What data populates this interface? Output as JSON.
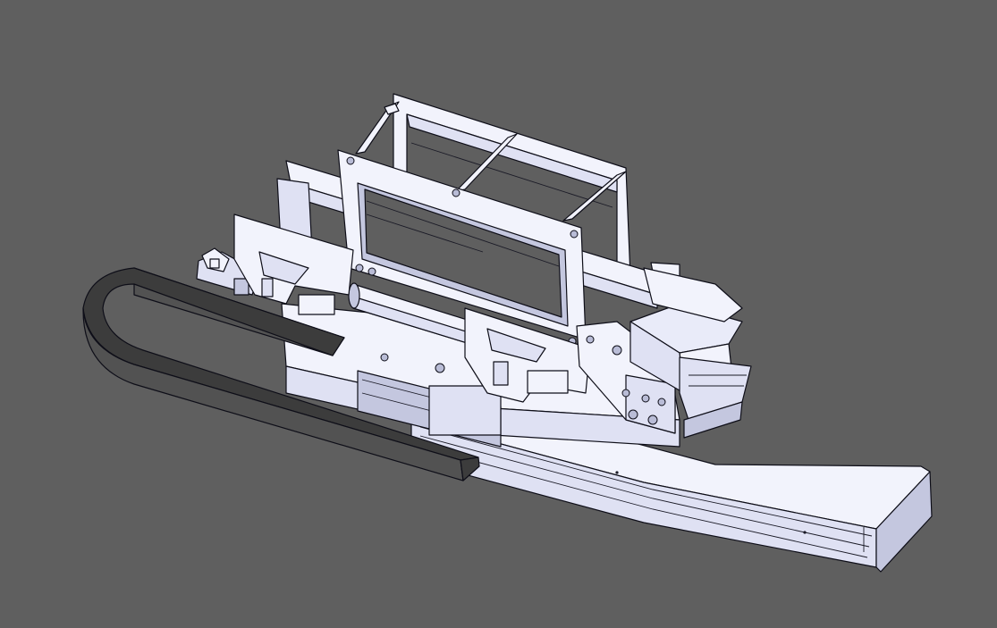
{
  "viewport": {
    "background_color": "#5f5f5f",
    "model_face_color": "#f2f3fc",
    "model_edge_color": "#0e0e18",
    "cable_chain_color": "#3c3c3c"
  },
  "model": {
    "components": [
      "linear-rail-base",
      "carriage-plate",
      "cable-drag-chain",
      "top-guard-frame",
      "front-square-frame",
      "guide-rods",
      "side-brackets",
      "pneumatic-cylinder",
      "gripper-block",
      "actuator-housing",
      "end-plate",
      "sensor-assembly"
    ]
  }
}
